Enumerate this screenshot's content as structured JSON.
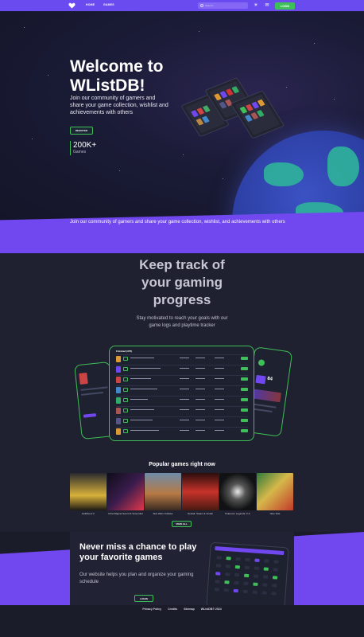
{
  "nav": {
    "links": [
      "HOME",
      "GAMES"
    ],
    "search_placeholder": "Search...",
    "login_label": "LOGIN",
    "icons": [
      "heart-logo-icon",
      "sun-icon",
      "chat-icon"
    ]
  },
  "hero": {
    "title": "Welcome to WListDB!",
    "subtitle": "Join our community of gamers and share your game collection, wishlist and achievements with others",
    "register_label": "REGISTER",
    "stat_value": "200K+",
    "stat_label": "Games"
  },
  "band": {
    "text": "Join our community of gamers and share your game collection, wishlist, and achievements with others"
  },
  "track": {
    "title": "Keep track of your gaming progress",
    "description": "Stay motivated to reach your goals with our game logs and playtime tracker",
    "tablet_header": "Finished (376)",
    "rating": "84"
  },
  "popular": {
    "title": "Popular games right now",
    "games": [
      {
        "name": "Helldivers 2",
        "c1": "#d8b13a",
        "c2": "#1d1a14"
      },
      {
        "name": "Ultra Magnet Sword & Scoundrel",
        "c1": "#e2364b",
        "c2": "#0f0d1a"
      },
      {
        "name": "Star Wars Outlaws",
        "c1": "#b77a45",
        "c2": "#3a2a22"
      },
      {
        "name": "Gestalt: Steam & Cinder",
        "c1": "#c7332a",
        "c2": "#2a0d0c"
      },
      {
        "name": "Pokémon Legends: Z-A",
        "c1": "#e9e9ea",
        "c2": "#111213"
      },
      {
        "name": "Nine Sols",
        "c1": "#d5b84a",
        "c2": "#c23a2a"
      }
    ],
    "view_all_label": "VIEW ALL"
  },
  "schedule": {
    "title": "Never miss a chance to play your favorite games",
    "description": "Our website helps you plan and organize your gaming schedule",
    "login_label": "LOGIN"
  },
  "footer": {
    "links": [
      "Privacy Policy",
      "Credits",
      "Sitemap",
      "WListDB© 2024"
    ]
  },
  "colors": {
    "accent_purple": "#7147f0",
    "accent_green": "#3fbf57",
    "background": "#1b1c2a"
  }
}
